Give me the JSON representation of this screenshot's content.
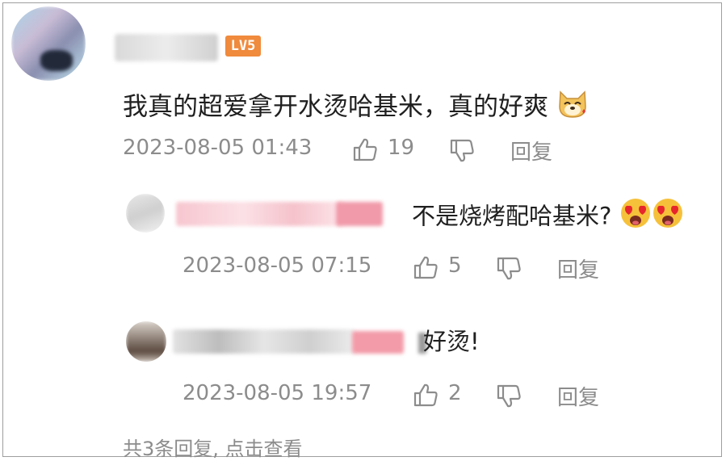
{
  "comment": {
    "level_badge": "LV5",
    "content": "我真的超爱拿开水烫哈基米，真的好爽",
    "timestamp": "2023-08-05 01:43",
    "likes": "19",
    "reply_label": "回复"
  },
  "replies": [
    {
      "content": "不是烧烤配哈基米?",
      "timestamp": "2023-08-05 07:15",
      "likes": "5",
      "reply_label": "回复"
    },
    {
      "content": "好烫!",
      "timestamp": "2023-08-05 19:57",
      "likes": "2",
      "reply_label": "回复"
    }
  ],
  "more_replies": "共3条回复, 点击查看",
  "colors": {
    "badge": "#f08a3c",
    "meta_text": "#8c8c8c",
    "blur_pink": "#f4a6b3"
  },
  "icons": [
    "thumbs-up-icon",
    "thumbs-down-icon",
    "dog-emoji-icon",
    "heart-eyes-emoji-icon"
  ]
}
